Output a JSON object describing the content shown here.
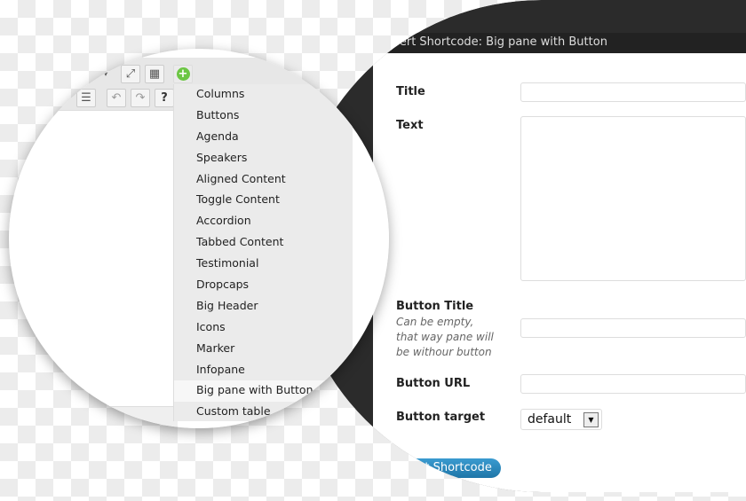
{
  "dialog": {
    "title": "Insert Shortcode: Big pane with Button",
    "fields": [
      {
        "label": "Title"
      },
      {
        "label": "Text"
      },
      {
        "label": "Button Title",
        "hint": "Can be empty, that way pane will be withour button"
      },
      {
        "label": "Button URL"
      },
      {
        "label": "Button target",
        "value": "default"
      }
    ],
    "submit": "Insert Shortcode"
  },
  "toolbar": {
    "icons": [
      "dropdown-arrow-icon",
      "fullscreen-icon",
      "keyboard-icon",
      "add-shortcode-icon",
      "indent-icon",
      "undo-icon",
      "redo-icon",
      "help-icon"
    ],
    "accent": "#6cc644"
  },
  "menu": {
    "items": [
      "Columns",
      "Buttons",
      "Agenda",
      "Speakers",
      "Aligned Content",
      "Toggle Content",
      "Accordion",
      "Tabbed Content",
      "Testimonial",
      "Dropcaps",
      "Big Header",
      "Icons",
      "Marker",
      "Infopane",
      "Big pane with Button",
      "Custom table"
    ],
    "highlighted": "Big pane with Button"
  }
}
